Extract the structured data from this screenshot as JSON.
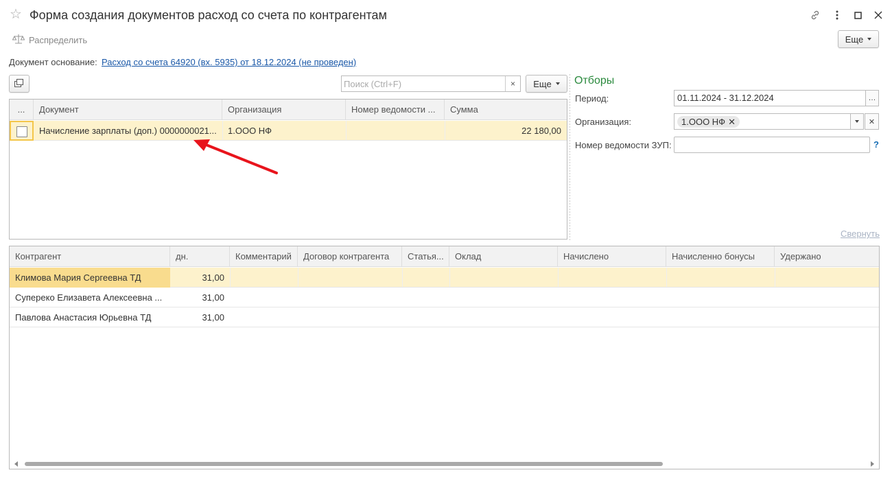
{
  "window": {
    "title": "Форма создания документов расход со счета по контрагентам"
  },
  "toolbar": {
    "distribute_label": "Распределить",
    "more_label": "Еще"
  },
  "basis": {
    "label": "Документ основание:",
    "link": "Расход со счета 64920 (вх. 5935) от 18.12.2024 (не проведен)"
  },
  "doc_table": {
    "search_placeholder": "Поиск (Ctrl+F)",
    "more_label": "Еще",
    "columns": [
      "...",
      "Документ",
      "Организация",
      "Номер ведомости ...",
      "Сумма"
    ],
    "rows": [
      {
        "document": "Начисление зарплаты (доп.) 0000000021...",
        "org": "1.ООО НФ",
        "number": "",
        "sum": "22 180,00"
      }
    ]
  },
  "filters": {
    "title": "Отборы",
    "period_label": "Период:",
    "period_value": "01.11.2024 - 31.12.2024",
    "org_label": "Организация:",
    "org_value": "1.ООО НФ",
    "zup_label": "Номер ведомости ЗУП:",
    "zup_value": "",
    "help": "?",
    "collapse_label": "Свернуть"
  },
  "contractors_table": {
    "columns": [
      "Контрагент",
      "дн.",
      "Комментарий",
      "Договор контрагента",
      "Статья...",
      "Оклад",
      "Начислено",
      "Начисленно бонусы",
      "Удержано"
    ],
    "rows": [
      {
        "name": "Климова Мария Сергеевна ТД",
        "days": "31,00"
      },
      {
        "name": "Супереко Елизавета Алексеевна ...",
        "days": "31,00"
      },
      {
        "name": "Павлова Анастасия Юрьевна ТД",
        "days": "31,00"
      }
    ]
  },
  "colors": {
    "selected_row": "#fdf2cc",
    "link": "#1a58a8",
    "filters_title": "#2b8a3e",
    "annotation_arrow": "#e8141c"
  }
}
